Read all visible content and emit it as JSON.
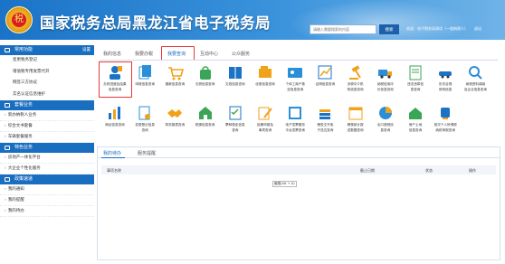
{
  "header": {
    "title": "国家税务总局黑龙江省电子税务局",
    "search_placeholder": "请输入需要搜索的内容",
    "search_button": "搜索",
    "user_info": "欢迎：电子税务局测试（一般纳税人）",
    "logout": "退出",
    "emblem_char": "税"
  },
  "sidebar": {
    "sections": [
      {
        "title": "常用功能",
        "more": "设置",
        "items": [
          "变更税务登记",
          "增值税专用发票代开",
          "网签三方协议",
          "实名认证信息维护"
        ]
      },
      {
        "title": "套餐业务",
        "more": "",
        "list": [
          "新办纳税人业务",
          "综合文书套餐",
          "车辆套餐服务"
        ]
      },
      {
        "title": "特色业务",
        "more": "",
        "list": [
          "房地产一体化平台",
          "大企业个性化服务"
        ]
      },
      {
        "title": "政策速递",
        "more": "",
        "list": [
          "我的通知",
          "我的提醒",
          "我的待办"
        ]
      }
    ]
  },
  "tabs": [
    {
      "label": "我的信息",
      "active": false
    },
    {
      "label": "我要办税",
      "active": false
    },
    {
      "label": "我要查询",
      "active": true
    },
    {
      "label": "互动中心",
      "active": false
    },
    {
      "label": "公众服务",
      "active": false
    }
  ],
  "query_icons": {
    "row1": [
      {
        "icon": "person-doc-icon",
        "label1": "办税进度及结果",
        "label2": "信息查询"
      },
      {
        "icon": "papers-icon",
        "label1": "申报信息查询",
        "label2": ""
      },
      {
        "icon": "cart-icon",
        "label1": "缴款信息查询",
        "label2": ""
      },
      {
        "icon": "bag-icon",
        "label1": "欠税信息查询",
        "label2": ""
      },
      {
        "icon": "book-icon",
        "label1": "文档信息查询",
        "label2": ""
      },
      {
        "icon": "folders-icon",
        "label1": "优惠信息查询",
        "label2": ""
      },
      {
        "icon": "id-card-icon",
        "label1": "个体工商户核",
        "label2": "定信息查询"
      },
      {
        "icon": "chart-icon",
        "label1": "证明信息查询",
        "label2": ""
      },
      {
        "icon": "gavel-icon",
        "label1": "涉税中介机",
        "label2": "构信息查询"
      },
      {
        "icon": "truck-icon",
        "label1": "纳税信用评",
        "label2": "价信息查询"
      },
      {
        "icon": "docs-icon",
        "label1": "违法违章信",
        "label2": "息查询"
      },
      {
        "icon": "cars-icon",
        "label1": "历次合规",
        "label2": "修改信息"
      },
      {
        "icon": "search-icon",
        "label1": "纳税资料调阅",
        "label2": "及企业信息查询"
      }
    ],
    "row2": [
      {
        "icon": "bar-stats-icon",
        "label1": "两证信息查询",
        "label2": ""
      },
      {
        "icon": "doc-gear-icon",
        "label1": "变更登记信息",
        "label2": "查询"
      },
      {
        "icon": "handshake-icon",
        "label1": "财务报表查询",
        "label2": ""
      },
      {
        "icon": "building-icon",
        "label1": "税源信息查询",
        "label2": ""
      },
      {
        "icon": "list-check-icon",
        "label1": "票种核定信息",
        "label2": "查询"
      },
      {
        "icon": "pen-paper-icon",
        "label1": "延期申报及",
        "label2": "事项查询"
      },
      {
        "icon": "ledger-icon",
        "label1": "电子发票服务",
        "label2": "平台发票查询"
      },
      {
        "icon": "stack-icon",
        "label1": "稽查文书电",
        "label2": "子送达查询"
      },
      {
        "icon": "calendar-icon",
        "label1": "稽核统计报",
        "label2": "送数据查询"
      },
      {
        "icon": "pie-icon",
        "label1": "出口退税信",
        "label2": "息查询"
      },
      {
        "icon": "house-icon",
        "label1": "房产土地",
        "label2": "信息查询"
      },
      {
        "icon": "cups-icon",
        "label1": "首次个人所得税",
        "label2": "纳税申报查询"
      }
    ]
  },
  "tasks": {
    "tabs": [
      {
        "label": "我的待办",
        "active": true
      },
      {
        "label": "服务提醒",
        "active": false
      }
    ],
    "columns": [
      "事项名称",
      "截止日期",
      "状态",
      "操作"
    ],
    "tooltip": "截图(Alt + A)"
  },
  "colors": {
    "header_start": "#1a73c7",
    "header_end": "#6fb3e8",
    "section_head": "#1a6ec0",
    "highlight": "#e53935"
  }
}
